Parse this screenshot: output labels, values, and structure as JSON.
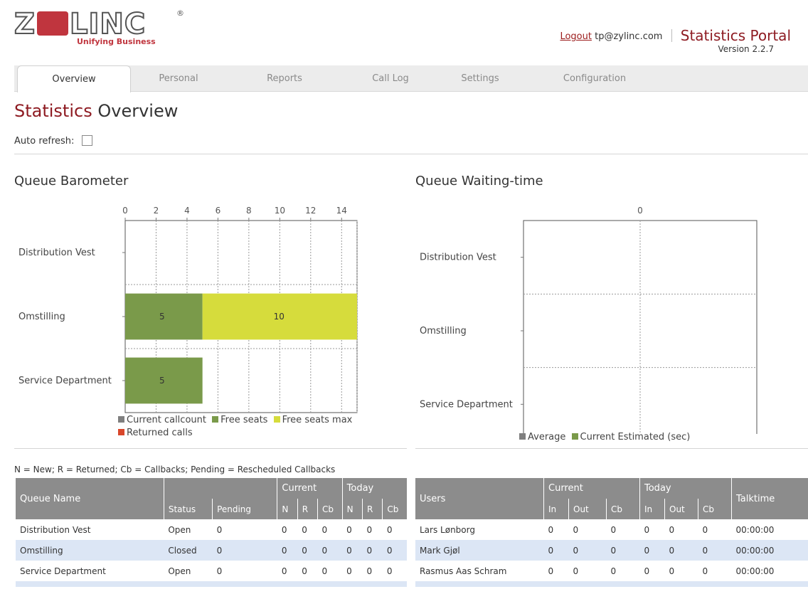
{
  "header": {
    "logo_word": "ZYLINC",
    "logo_reg": "®",
    "logo_tagline": "Unifying Business",
    "logout_label": "Logout",
    "user_email": "tp@zylinc.com",
    "portal_title": "Statistics Portal",
    "version": "Version 2.2.7"
  },
  "tabs": [
    {
      "label": "Overview",
      "active": true
    },
    {
      "label": "Personal",
      "active": false
    },
    {
      "label": "Reports",
      "active": false
    },
    {
      "label": "Call Log",
      "active": false
    },
    {
      "label": "Settings",
      "active": false
    },
    {
      "label": "Configuration",
      "active": false
    }
  ],
  "page_title": {
    "em": "Statistics",
    "rest": " Overview"
  },
  "auto_refresh": {
    "label": "Auto refresh:",
    "checked": false
  },
  "colors": {
    "brand": "#8e1b22",
    "current_callcount": "#7f7f7f",
    "free_seats": "#7a9a4a",
    "free_seats_max": "#d6dc3c",
    "returned_calls": "#d9472b",
    "average": "#7f7f7f",
    "current_estimated": "#7a9a4a"
  },
  "chart_data": [
    {
      "type": "bar",
      "orientation": "horizontal",
      "stacked": true,
      "title": "Queue Barometer",
      "categories": [
        "Distribution Vest",
        "Omstilling",
        "Service Department"
      ],
      "series": [
        {
          "name": "Current callcount",
          "values": [
            0,
            0,
            0
          ]
        },
        {
          "name": "Free seats",
          "values": [
            0,
            5,
            5
          ]
        },
        {
          "name": "Free seats max",
          "values": [
            0,
            10,
            0
          ]
        },
        {
          "name": "Returned calls",
          "values": [
            0,
            0,
            0
          ]
        }
      ],
      "data_labels": [
        [],
        [
          "5",
          "10"
        ],
        [
          "5"
        ]
      ],
      "xticks": [
        0,
        2,
        4,
        6,
        8,
        10,
        12,
        14
      ],
      "xlim": [
        0,
        15
      ],
      "axis_position": "top",
      "grid": true,
      "legend": "bottom"
    },
    {
      "type": "bar",
      "orientation": "horizontal",
      "title": "Queue Waiting-time",
      "categories": [
        "Distribution Vest",
        "Omstilling",
        "Service Department"
      ],
      "series": [
        {
          "name": "Average",
          "values": [
            0,
            0,
            0
          ]
        },
        {
          "name": "Current Estimated (sec)",
          "values": [
            0,
            0,
            0
          ]
        }
      ],
      "xticks": [
        0
      ],
      "axis_position": "top",
      "grid": true,
      "legend": "bottom"
    }
  ],
  "legend_note": "N = New; R = Returned; Cb = Callbacks; Pending = Rescheduled Callbacks",
  "queue_table": {
    "header_queue_name": "Queue Name",
    "group_current": "Current",
    "group_today": "Today",
    "sub_headers": [
      "Status",
      "Pending",
      "N",
      "R",
      "Cb",
      "N",
      "R",
      "Cb"
    ],
    "rows": [
      [
        "Distribution Vest",
        "Open",
        "0",
        "0",
        "0",
        "0",
        "0",
        "0",
        "0"
      ],
      [
        "Omstilling",
        "Closed",
        "0",
        "0",
        "0",
        "0",
        "0",
        "0",
        "0"
      ],
      [
        "Service Department",
        "Open",
        "0",
        "0",
        "0",
        "0",
        "0",
        "0",
        "0"
      ]
    ]
  },
  "users_table": {
    "header_users": "Users",
    "group_current": "Current",
    "group_today": "Today",
    "header_talktime": "Talktime",
    "sub_headers": [
      "In",
      "Out",
      "Cb",
      "In",
      "Out",
      "Cb"
    ],
    "rows": [
      [
        "Lars Lønborg",
        "0",
        "0",
        "0",
        "0",
        "0",
        "0",
        "00:00:00"
      ],
      [
        "Mark Gjøl",
        "0",
        "0",
        "0",
        "0",
        "0",
        "0",
        "00:00:00"
      ],
      [
        "Rasmus Aas Schram",
        "0",
        "0",
        "0",
        "0",
        "0",
        "0",
        "00:00:00"
      ]
    ]
  }
}
